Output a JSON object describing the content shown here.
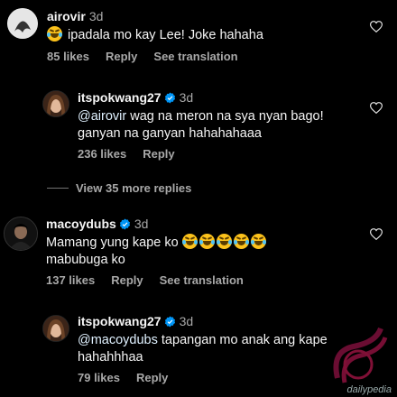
{
  "comments": [
    {
      "username": "airovir",
      "time": "3d",
      "text": "ipadala mo kay Lee! Joke hahaha",
      "likes": "85 likes",
      "reply": "Reply",
      "translate": "See translation"
    },
    {
      "username": "itspokwang27",
      "time": "3d",
      "mention": "@airovir",
      "text": "wag na meron na sya nyan bago! ganyan na ganyan hahahahaaa",
      "likes": "236 likes",
      "reply": "Reply"
    },
    {
      "username": "macoydubs",
      "time": "3d",
      "text": "Mamang yung kape ko",
      "text2": "mabubuga ko",
      "likes": "137 likes",
      "reply": "Reply",
      "translate": "See translation"
    },
    {
      "username": "itspokwang27",
      "time": "3d",
      "mention": "@macoydubs",
      "text": "tapangan mo anak ang kape hahahhhaa",
      "likes": "79 likes",
      "reply": "Reply"
    }
  ],
  "view_more": "View 35 more replies",
  "watermark": "dailypedia",
  "icons": {
    "heart": "heart-outline-icon",
    "verified": "verified-badge-icon",
    "emoji": "face-with-tears-of-joy-emoji"
  },
  "colors": {
    "background": "#000000",
    "verified": "#0095f6",
    "muted": "#a8a8a8"
  }
}
